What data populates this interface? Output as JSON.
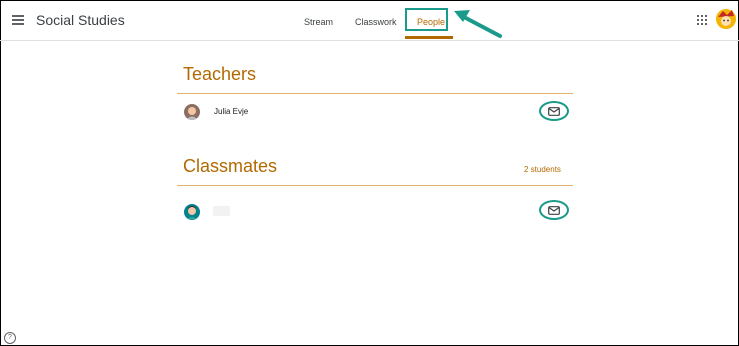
{
  "header": {
    "title": "Social Studies",
    "tabs": [
      {
        "label": "Stream"
      },
      {
        "label": "Classwork"
      },
      {
        "label": "People"
      }
    ],
    "active_tab": "People"
  },
  "teachers": {
    "title": "Teachers",
    "members": [
      {
        "name": "Julia Evje"
      }
    ]
  },
  "classmates": {
    "title": "Classmates",
    "count_label": "2 students"
  },
  "help": {
    "label": "?"
  },
  "colors": {
    "accent": "#b26a00",
    "annotation": "#1a9a8a",
    "divider": "#e2b36a"
  }
}
